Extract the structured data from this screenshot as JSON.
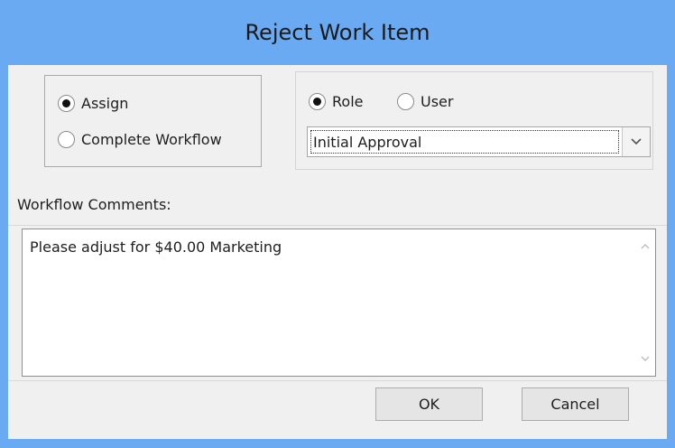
{
  "window": {
    "title": "Reject Work Item"
  },
  "action_group": {
    "options": [
      {
        "label": "Assign",
        "checked": true
      },
      {
        "label": "Complete Workflow",
        "checked": false
      }
    ]
  },
  "assign_group": {
    "target_options": [
      {
        "label": "Role",
        "checked": true
      },
      {
        "label": "User",
        "checked": false
      }
    ],
    "combo": {
      "selected": "Initial Approval",
      "icon": "chevron-down-icon"
    }
  },
  "comments": {
    "label": "Workflow Comments:",
    "text": "Please adjust for $40.00 Marketing"
  },
  "buttons": {
    "ok": "OK",
    "cancel": "Cancel"
  },
  "colors": {
    "window_chrome": "#6aaaf2",
    "client_background": "#f0f0f0",
    "button_face": "#e5e5e5"
  }
}
